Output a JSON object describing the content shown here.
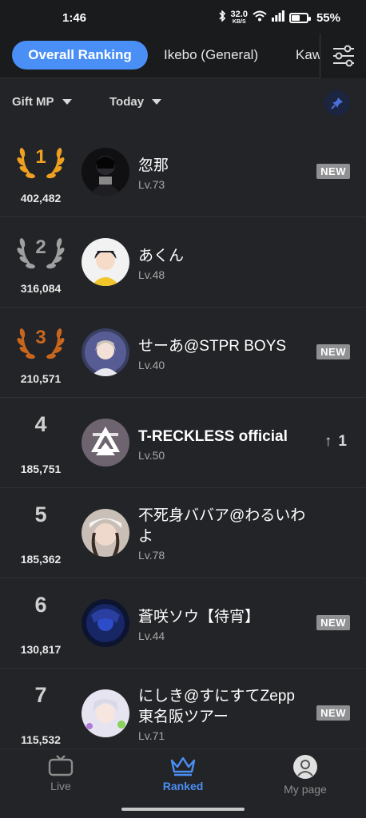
{
  "status": {
    "time": "1:46",
    "speed_value": "32.0",
    "speed_unit": "KB/S",
    "battery": "55%",
    "battery_level": 0.55
  },
  "tabs": [
    {
      "label": "Overall Ranking",
      "active": true
    },
    {
      "label": "Ikebo (General)",
      "active": false
    },
    {
      "label": "Kaw",
      "active": false
    }
  ],
  "filters": {
    "metric": "Gift MP",
    "period": "Today"
  },
  "rankings": [
    {
      "rank": "1",
      "score": "402,482",
      "name": "忽那",
      "level": "Lv.73",
      "badge": "NEW",
      "trend": "",
      "trend_value": ""
    },
    {
      "rank": "2",
      "score": "316,084",
      "name": "あくん",
      "level": "Lv.48",
      "badge": "",
      "trend": "",
      "trend_value": ""
    },
    {
      "rank": "3",
      "score": "210,571",
      "name": "せーあ@STPR BOYS",
      "level": "Lv.40",
      "badge": "NEW",
      "trend": "",
      "trend_value": ""
    },
    {
      "rank": "4",
      "score": "185,751",
      "name": "T-RECKLESS official",
      "level": "Lv.50",
      "badge": "",
      "trend": "↑",
      "trend_value": "1"
    },
    {
      "rank": "5",
      "score": "185,362",
      "name": "不死身ババア@わるいわよ",
      "level": "Lv.78",
      "badge": "",
      "trend": "",
      "trend_value": ""
    },
    {
      "rank": "6",
      "score": "130,817",
      "name": "蒼咲ソウ【待宵】",
      "level": "Lv.44",
      "badge": "NEW",
      "trend": "",
      "trend_value": ""
    },
    {
      "rank": "7",
      "score": "115,532",
      "name": "にしき@すにすてZepp東名阪ツアー",
      "level": "Lv.71",
      "badge": "NEW",
      "trend": "",
      "trend_value": ""
    }
  ],
  "nav": {
    "live": "Live",
    "ranked": "Ranked",
    "mypage": "My page"
  },
  "colors": {
    "accent": "#4a8ff5",
    "gold": "#f0a020",
    "silver": "#a0a0a0",
    "bronze": "#c8661e",
    "badge": "#8f9092"
  }
}
